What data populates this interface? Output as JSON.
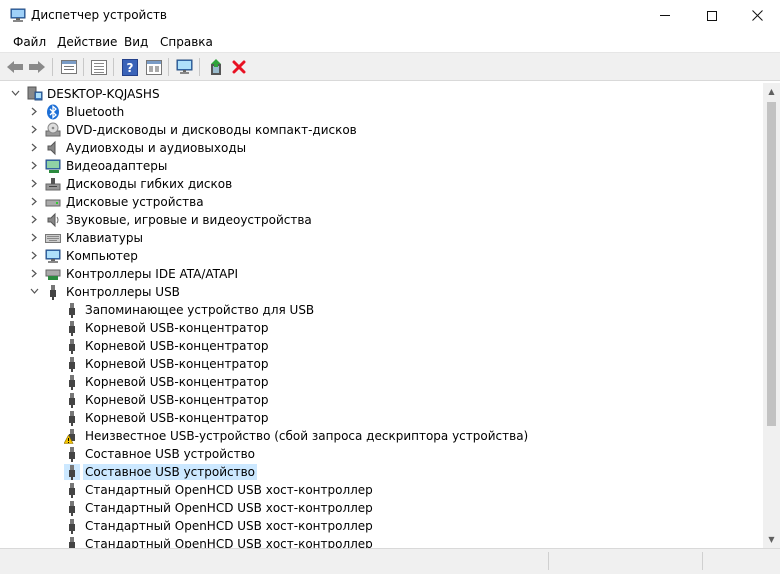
{
  "window": {
    "title": "Диспетчер устройств"
  },
  "menu": [
    "Файл",
    "Действие",
    "Вид",
    "Справка"
  ],
  "toolbar": {
    "buttons": [
      "back-icon",
      "forward-icon",
      "properties-icon",
      "show-list-icon",
      "help-icon",
      "view-icon",
      "scan-hardware-icon",
      "update-driver-icon",
      "uninstall-icon"
    ]
  },
  "tree": {
    "root": "DESKTOP-KQJASHS",
    "categories": [
      "Bluetooth",
      "DVD-дисководы и дисководы компакт-дисков",
      "Аудиовходы и аудиовыходы",
      "Видеоадаптеры",
      "Дисководы гибких дисков",
      "Дисковые устройства",
      "Звуковые, игровые и видеоустройства",
      "Клавиатуры",
      "Компьютер",
      "Контроллеры IDE ATA/ATAPI",
      "Контроллеры USB"
    ],
    "usb_devices": [
      "Запоминающее устройство для USB",
      "Корневой USB-концентратор",
      "Корневой USB-концентратор",
      "Корневой USB-концентратор",
      "Корневой USB-концентратор",
      "Корневой USB-концентратор",
      "Корневой USB-концентратор",
      "Неизвестное USB-устройство (сбой запроса дескриптора устройства)",
      "Составное USB устройство",
      "Составное USB устройство",
      "Стандартный OpenHCD USB хост-контроллер",
      "Стандартный OpenHCD USB хост-контроллер",
      "Стандартный OpenHCD USB хост-контроллер",
      "Стандартный OpenHCD USB хост-контроллер"
    ]
  },
  "colors": {
    "selection": "#cce8ff",
    "toolbar_bg": "#f0f0f0",
    "warning": "#f2c200",
    "delete": "#e81123"
  }
}
